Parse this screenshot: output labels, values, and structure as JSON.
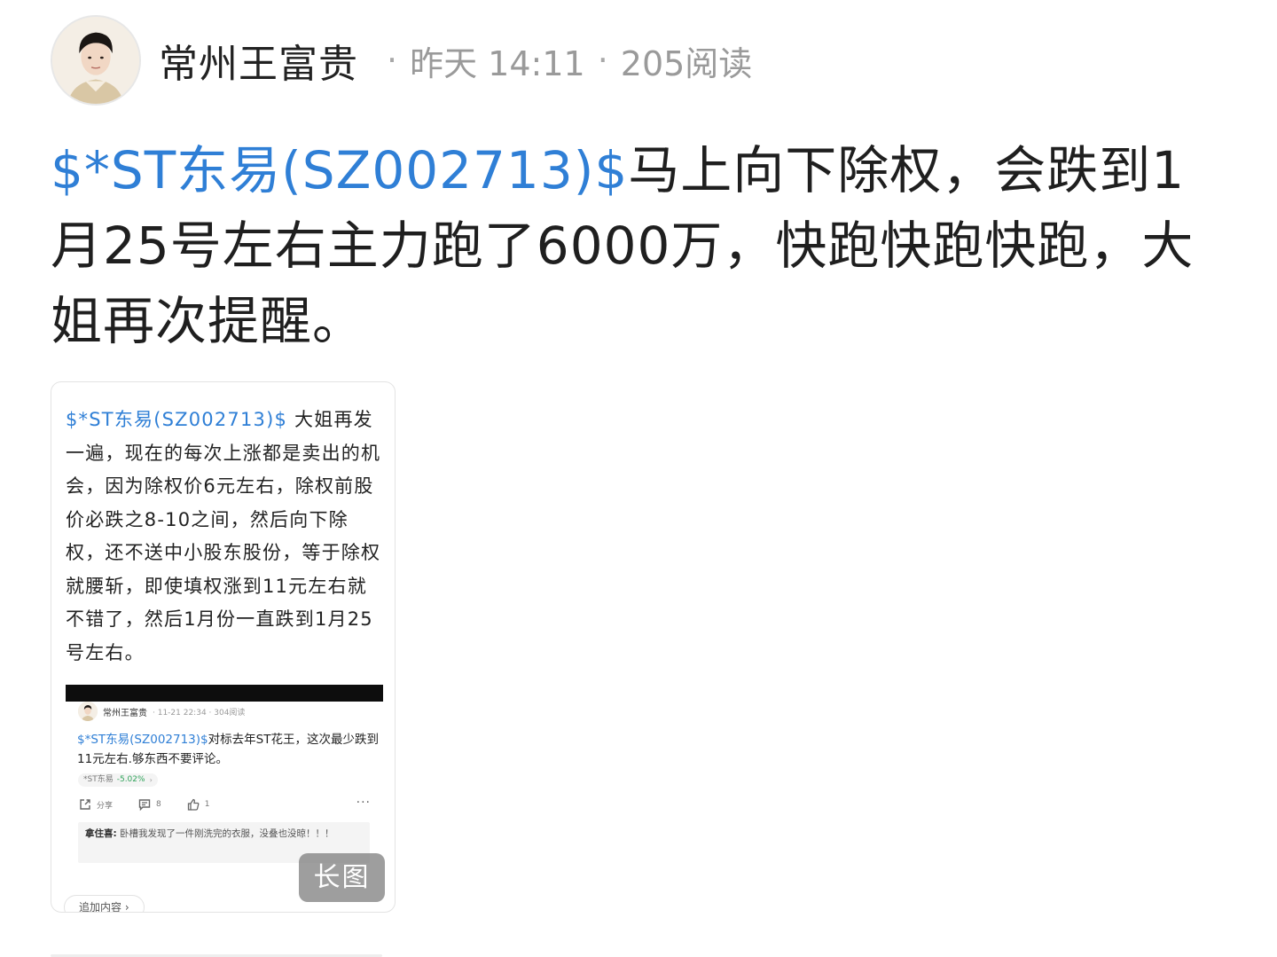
{
  "header": {
    "author": "常州王富贵",
    "separator": "·",
    "time": "昨天 14:11",
    "reads": "205阅读"
  },
  "post": {
    "stock_link": "$*ST东易(SZ002713)$",
    "body": "马上向下除权，会跌到1月25号左右主力跑了6000万，快跑快跑快跑，大姐再次提醒。"
  },
  "card": {
    "stock_link": "$*ST东易(SZ002713)$",
    "body": "大姐再发一遍，现在的每次上涨都是卖出的机会，因为除权价6元左右，除权前股价必跌之8-10之间，然后向下除权，还不送中小股东股份，等于除权就腰斩，即使填权涨到11元左右就不错了，然后1月份一直跌到1月25号左右。",
    "nested": {
      "author": "常州王富贵",
      "meta": "· 11-21 22:34 · 304阅读",
      "stock_link": "$*ST东易(SZ002713)$",
      "body": "对标去年ST花王，这次最少跌到11元左右.够东西不要评论。",
      "quote_name": "*ST东易",
      "quote_change": "-5.02%",
      "quote_chevron": "›",
      "share_label": "分享",
      "comment_count": "8",
      "like_count": "1",
      "more": "···",
      "comment_author": "拿住喜:",
      "comment_text": " 卧槽我发现了一件刚洗完的衣服，没叠也没晾！！！"
    },
    "badge": "长图",
    "add_content": "追加内容 ›"
  },
  "colors": {
    "link": "#2f7fd6",
    "meta": "#9a9a9a",
    "quote_down": "#2fa35a"
  }
}
